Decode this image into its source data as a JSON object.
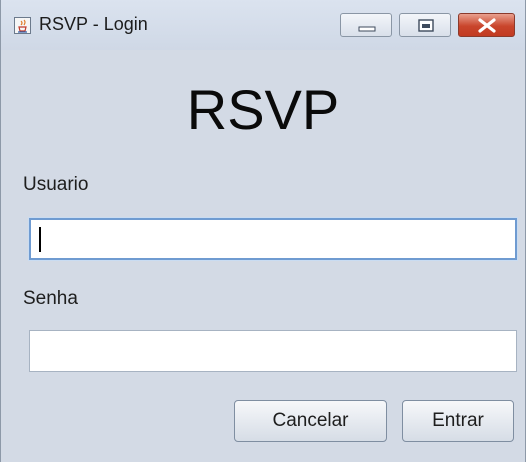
{
  "window": {
    "title": "RSVP - Login",
    "icon": "java-cup-icon",
    "controls": {
      "minimize_icon": "minimize-icon",
      "maximize_icon": "maximize-icon",
      "close_icon": "close-icon",
      "close_color": "#c8452d"
    }
  },
  "form": {
    "heading": "RSVP",
    "username": {
      "label": "Usuario",
      "value": ""
    },
    "password": {
      "label": "Senha",
      "value": ""
    },
    "buttons": {
      "cancel_label": "Cancelar",
      "submit_label": "Entrar"
    }
  },
  "colors": {
    "background": "#d3dae5",
    "focus_border": "#6f9bd1"
  }
}
